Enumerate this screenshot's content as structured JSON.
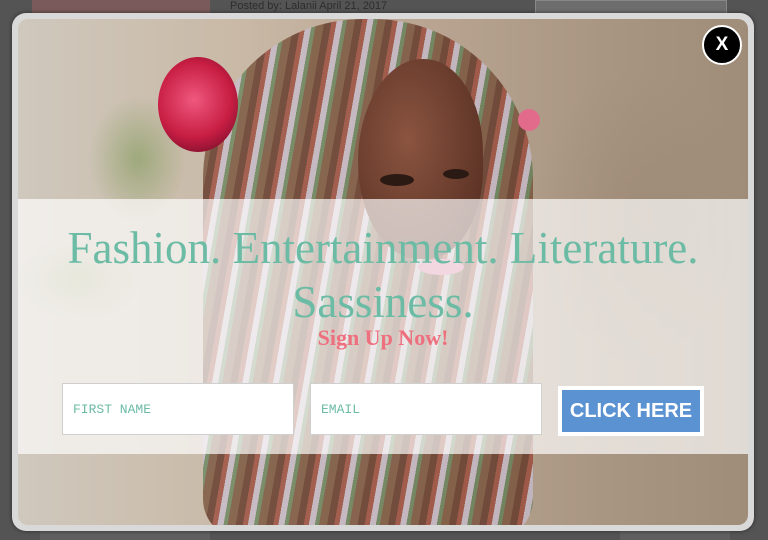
{
  "background_page": {
    "post_meta": "Posted by: Lalanii April 21, 2017"
  },
  "modal": {
    "close_label": "X",
    "headline": "Fashion. Entertainment. Literature. Sassiness.",
    "subheadline": "Sign Up Now!",
    "form": {
      "first_name_placeholder": "FIRST NAME",
      "email_placeholder": "EMAIL",
      "submit_label": "CLICK HERE"
    }
  },
  "colors": {
    "headline": "#6cbba5",
    "subheadline": "#ee6f7e",
    "button": "#5b92d2",
    "close_button": "#000000"
  },
  "icons": {
    "close": "close-icon"
  }
}
